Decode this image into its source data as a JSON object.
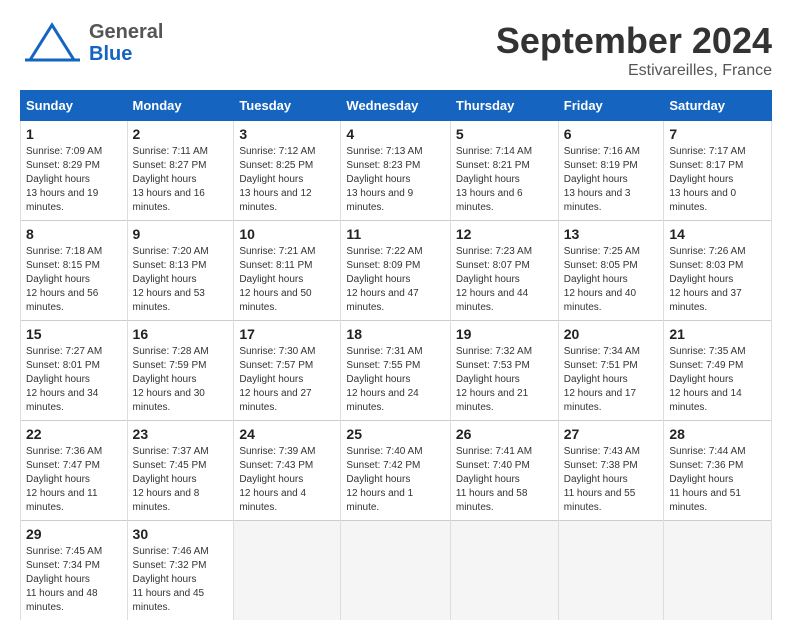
{
  "header": {
    "logo_general": "General",
    "logo_blue": "Blue",
    "month_title": "September 2024",
    "location": "Estivareilles, France"
  },
  "columns": [
    "Sunday",
    "Monday",
    "Tuesday",
    "Wednesday",
    "Thursday",
    "Friday",
    "Saturday"
  ],
  "weeks": [
    [
      {
        "day": "1",
        "sunrise": "Sunrise: 7:09 AM",
        "sunset": "Sunset: 8:29 PM",
        "daylight": "Daylight: 13 hours and 19 minutes."
      },
      {
        "day": "2",
        "sunrise": "Sunrise: 7:11 AM",
        "sunset": "Sunset: 8:27 PM",
        "daylight": "Daylight: 13 hours and 16 minutes."
      },
      {
        "day": "3",
        "sunrise": "Sunrise: 7:12 AM",
        "sunset": "Sunset: 8:25 PM",
        "daylight": "Daylight: 13 hours and 12 minutes."
      },
      {
        "day": "4",
        "sunrise": "Sunrise: 7:13 AM",
        "sunset": "Sunset: 8:23 PM",
        "daylight": "Daylight: 13 hours and 9 minutes."
      },
      {
        "day": "5",
        "sunrise": "Sunrise: 7:14 AM",
        "sunset": "Sunset: 8:21 PM",
        "daylight": "Daylight: 13 hours and 6 minutes."
      },
      {
        "day": "6",
        "sunrise": "Sunrise: 7:16 AM",
        "sunset": "Sunset: 8:19 PM",
        "daylight": "Daylight: 13 hours and 3 minutes."
      },
      {
        "day": "7",
        "sunrise": "Sunrise: 7:17 AM",
        "sunset": "Sunset: 8:17 PM",
        "daylight": "Daylight: 13 hours and 0 minutes."
      }
    ],
    [
      {
        "day": "8",
        "sunrise": "Sunrise: 7:18 AM",
        "sunset": "Sunset: 8:15 PM",
        "daylight": "Daylight: 12 hours and 56 minutes."
      },
      {
        "day": "9",
        "sunrise": "Sunrise: 7:20 AM",
        "sunset": "Sunset: 8:13 PM",
        "daylight": "Daylight: 12 hours and 53 minutes."
      },
      {
        "day": "10",
        "sunrise": "Sunrise: 7:21 AM",
        "sunset": "Sunset: 8:11 PM",
        "daylight": "Daylight: 12 hours and 50 minutes."
      },
      {
        "day": "11",
        "sunrise": "Sunrise: 7:22 AM",
        "sunset": "Sunset: 8:09 PM",
        "daylight": "Daylight: 12 hours and 47 minutes."
      },
      {
        "day": "12",
        "sunrise": "Sunrise: 7:23 AM",
        "sunset": "Sunset: 8:07 PM",
        "daylight": "Daylight: 12 hours and 44 minutes."
      },
      {
        "day": "13",
        "sunrise": "Sunrise: 7:25 AM",
        "sunset": "Sunset: 8:05 PM",
        "daylight": "Daylight: 12 hours and 40 minutes."
      },
      {
        "day": "14",
        "sunrise": "Sunrise: 7:26 AM",
        "sunset": "Sunset: 8:03 PM",
        "daylight": "Daylight: 12 hours and 37 minutes."
      }
    ],
    [
      {
        "day": "15",
        "sunrise": "Sunrise: 7:27 AM",
        "sunset": "Sunset: 8:01 PM",
        "daylight": "Daylight: 12 hours and 34 minutes."
      },
      {
        "day": "16",
        "sunrise": "Sunrise: 7:28 AM",
        "sunset": "Sunset: 7:59 PM",
        "daylight": "Daylight: 12 hours and 30 minutes."
      },
      {
        "day": "17",
        "sunrise": "Sunrise: 7:30 AM",
        "sunset": "Sunset: 7:57 PM",
        "daylight": "Daylight: 12 hours and 27 minutes."
      },
      {
        "day": "18",
        "sunrise": "Sunrise: 7:31 AM",
        "sunset": "Sunset: 7:55 PM",
        "daylight": "Daylight: 12 hours and 24 minutes."
      },
      {
        "day": "19",
        "sunrise": "Sunrise: 7:32 AM",
        "sunset": "Sunset: 7:53 PM",
        "daylight": "Daylight: 12 hours and 21 minutes."
      },
      {
        "day": "20",
        "sunrise": "Sunrise: 7:34 AM",
        "sunset": "Sunset: 7:51 PM",
        "daylight": "Daylight: 12 hours and 17 minutes."
      },
      {
        "day": "21",
        "sunrise": "Sunrise: 7:35 AM",
        "sunset": "Sunset: 7:49 PM",
        "daylight": "Daylight: 12 hours and 14 minutes."
      }
    ],
    [
      {
        "day": "22",
        "sunrise": "Sunrise: 7:36 AM",
        "sunset": "Sunset: 7:47 PM",
        "daylight": "Daylight: 12 hours and 11 minutes."
      },
      {
        "day": "23",
        "sunrise": "Sunrise: 7:37 AM",
        "sunset": "Sunset: 7:45 PM",
        "daylight": "Daylight: 12 hours and 8 minutes."
      },
      {
        "day": "24",
        "sunrise": "Sunrise: 7:39 AM",
        "sunset": "Sunset: 7:43 PM",
        "daylight": "Daylight: 12 hours and 4 minutes."
      },
      {
        "day": "25",
        "sunrise": "Sunrise: 7:40 AM",
        "sunset": "Sunset: 7:42 PM",
        "daylight": "Daylight: 12 hours and 1 minute."
      },
      {
        "day": "26",
        "sunrise": "Sunrise: 7:41 AM",
        "sunset": "Sunset: 7:40 PM",
        "daylight": "Daylight: 11 hours and 58 minutes."
      },
      {
        "day": "27",
        "sunrise": "Sunrise: 7:43 AM",
        "sunset": "Sunset: 7:38 PM",
        "daylight": "Daylight: 11 hours and 55 minutes."
      },
      {
        "day": "28",
        "sunrise": "Sunrise: 7:44 AM",
        "sunset": "Sunset: 7:36 PM",
        "daylight": "Daylight: 11 hours and 51 minutes."
      }
    ],
    [
      {
        "day": "29",
        "sunrise": "Sunrise: 7:45 AM",
        "sunset": "Sunset: 7:34 PM",
        "daylight": "Daylight: 11 hours and 48 minutes."
      },
      {
        "day": "30",
        "sunrise": "Sunrise: 7:46 AM",
        "sunset": "Sunset: 7:32 PM",
        "daylight": "Daylight: 11 hours and 45 minutes."
      },
      null,
      null,
      null,
      null,
      null
    ]
  ]
}
